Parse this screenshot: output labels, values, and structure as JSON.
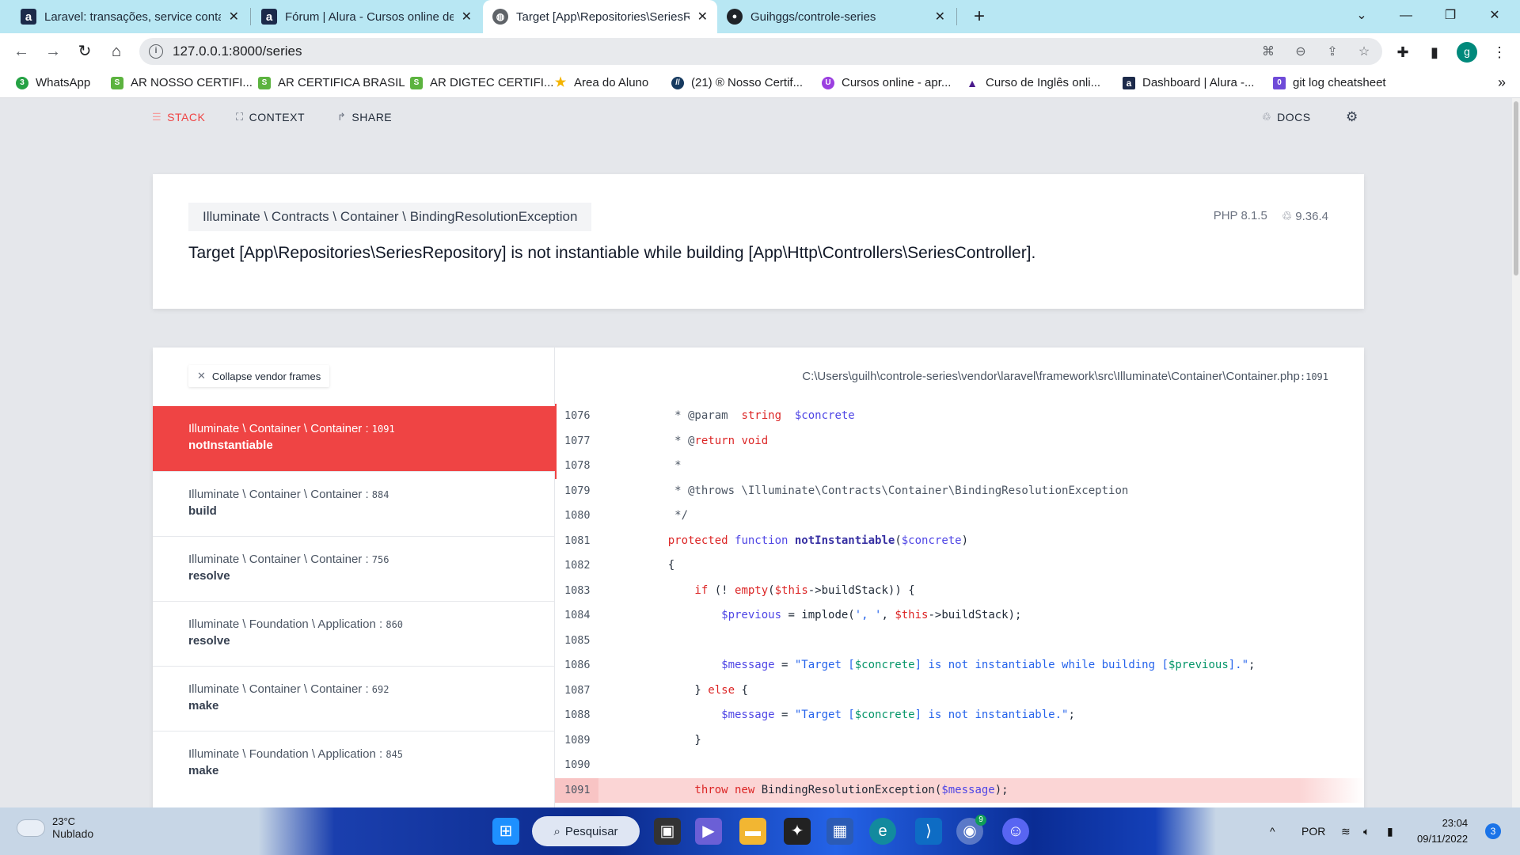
{
  "browser": {
    "tabs": [
      {
        "label": "Laravel: transações, service conta",
        "icon": "alura-icon",
        "active": false
      },
      {
        "label": "Fórum | Alura - Cursos online de",
        "icon": "alura-icon",
        "active": false
      },
      {
        "label": "Target [App\\Repositories\\SeriesR",
        "icon": "globe-icon",
        "active": true
      },
      {
        "label": "Guihggs/controle-series",
        "icon": "github-icon",
        "active": false
      }
    ],
    "close_glyph": "✕",
    "new_tab_glyph": "+",
    "url": "127.0.0.1:8000/series",
    "profile_initial": "g",
    "bookmarks": [
      {
        "label": "WhatsApp",
        "icon": "whatsapp-icon",
        "color": "#25a244",
        "glyph": "3"
      },
      {
        "label": "AR NOSSO CERTIFI...",
        "icon": "ar-certificado-icon",
        "color": "#5cb33f",
        "glyph": "S"
      },
      {
        "label": "AR CERTIFICA BRASIL",
        "icon": "ar-certificado-icon",
        "color": "#5cb33f",
        "glyph": "S"
      },
      {
        "label": "AR DIGTEC CERTIFI...",
        "icon": "ar-certificado-icon",
        "color": "#5cb33f",
        "glyph": "S"
      },
      {
        "label": "Area do Aluno",
        "icon": "star-icon",
        "color": "#f4b400",
        "glyph": "★"
      },
      {
        "label": "(21) ® Nosso Certif...",
        "icon": "nosso-certificado-icon",
        "color": "#163a5f",
        "glyph": "//"
      },
      {
        "label": "Cursos online - apr...",
        "icon": "cursos-online-icon",
        "color": "#9b3fe0",
        "glyph": "U"
      },
      {
        "label": "Curso de Inglês onli...",
        "icon": "sail-icon",
        "color": "#4a1a8c",
        "glyph": "▲"
      },
      {
        "label": "Dashboard | Alura -...",
        "icon": "alura-icon",
        "color": "#1c2a4a",
        "glyph": "a"
      },
      {
        "label": "git log cheatsheet",
        "icon": "paperclip-icon",
        "color": "#6f4bd8",
        "glyph": "0"
      }
    ],
    "bookmarks_more": "»"
  },
  "ignition": {
    "nav": {
      "stack": "STACK",
      "context": "CONTEXT",
      "share": "SHARE",
      "docs": "DOCS"
    },
    "exception": {
      "class": "Illuminate \\ Contracts \\ Container \\ BindingResolutionException",
      "php_version": "PHP 8.1.5",
      "laravel_version": "9.36.4",
      "message": "Target [App\\Repositories\\SeriesRepository] is not instantiable while building [App\\Http\\Controllers\\SeriesController]."
    },
    "collapse_vendor_frames": "Collapse vendor frames",
    "frames": [
      {
        "class": "Illuminate \\ Container \\ Container",
        "line": "1091",
        "function": "notInstantiable",
        "selected": true
      },
      {
        "class": "Illuminate \\ Container \\ Container",
        "line": "884",
        "function": "build",
        "selected": false
      },
      {
        "class": "Illuminate \\ Container \\ Container",
        "line": "756",
        "function": "resolve",
        "selected": false
      },
      {
        "class": "Illuminate \\ Foundation \\ Application",
        "line": "860",
        "function": "resolve",
        "selected": false
      },
      {
        "class": "Illuminate \\ Container \\ Container",
        "line": "692",
        "function": "make",
        "selected": false
      },
      {
        "class": "Illuminate \\ Foundation \\ Application",
        "line": "845",
        "function": "make",
        "selected": false
      }
    ],
    "file": {
      "path": "C:\\Users\\guilh\\controle-series\\vendor\\laravel\\framework\\src\\Illuminate\\Container\\Container.php",
      "line": "1091"
    },
    "highlighted_line": "1091",
    "code_lines": [
      {
        "no": "1076",
        "tokens": [
          [
            "c",
            "     * @param  "
          ],
          [
            "k",
            "string"
          ],
          [
            "c",
            "  "
          ],
          [
            "v",
            "$concrete"
          ]
        ]
      },
      {
        "no": "1077",
        "tokens": [
          [
            "c",
            "     * @"
          ],
          [
            "k",
            "return void"
          ]
        ]
      },
      {
        "no": "1078",
        "tokens": [
          [
            "c",
            "     *"
          ]
        ]
      },
      {
        "no": "1079",
        "tokens": [
          [
            "c",
            "     * @throws \\Illuminate\\Contracts\\Container\\BindingResolutionException"
          ]
        ]
      },
      {
        "no": "1080",
        "tokens": [
          [
            "c",
            "     */"
          ]
        ]
      },
      {
        "no": "1081",
        "tokens": [
          [
            "k",
            "    protected "
          ],
          [
            "v",
            "function "
          ],
          [
            "fnn",
            "notInstantiable"
          ],
          [
            "",
            "("
          ],
          [
            "v",
            "$concrete"
          ],
          [
            "",
            ")"
          ]
        ]
      },
      {
        "no": "1082",
        "tokens": [
          [
            "",
            "    {"
          ]
        ]
      },
      {
        "no": "1083",
        "tokens": [
          [
            "k",
            "        if "
          ],
          [
            "",
            "(! "
          ],
          [
            "k",
            "empty"
          ],
          [
            "",
            "("
          ],
          [
            "k",
            "$this"
          ],
          [
            "",
            "->buildStack)) {"
          ]
        ]
      },
      {
        "no": "1084",
        "tokens": [
          [
            "v",
            "            $previous"
          ],
          [
            "",
            " = implode("
          ],
          [
            "s",
            "', '"
          ],
          [
            "",
            ", "
          ],
          [
            "k",
            "$this"
          ],
          [
            "",
            "->buildStack);"
          ]
        ]
      },
      {
        "no": "1085",
        "tokens": [
          [
            "",
            ""
          ]
        ]
      },
      {
        "no": "1086",
        "tokens": [
          [
            "v",
            "            $message"
          ],
          [
            "",
            " = "
          ],
          [
            "s",
            "\"Target ["
          ],
          [
            "g",
            "$concrete"
          ],
          [
            "s",
            "] is not instantiable while building ["
          ],
          [
            "g",
            "$previous"
          ],
          [
            "s",
            "].\""
          ],
          [
            "",
            ";"
          ]
        ]
      },
      {
        "no": "1087",
        "tokens": [
          [
            "",
            "        } "
          ],
          [
            "k",
            "else"
          ],
          [
            "",
            " {"
          ]
        ]
      },
      {
        "no": "1088",
        "tokens": [
          [
            "v",
            "            $message"
          ],
          [
            "",
            " = "
          ],
          [
            "s",
            "\"Target ["
          ],
          [
            "g",
            "$concrete"
          ],
          [
            "s",
            "] is not instantiable.\""
          ],
          [
            "",
            ";"
          ]
        ]
      },
      {
        "no": "1089",
        "tokens": [
          [
            "",
            "        }"
          ]
        ]
      },
      {
        "no": "1090",
        "tokens": [
          [
            "",
            ""
          ]
        ]
      },
      {
        "no": "1091",
        "tokens": [
          [
            "k",
            "        throw new "
          ],
          [
            "",
            "BindingResolutionException("
          ],
          [
            "v",
            "$message"
          ],
          [
            "",
            ");"
          ]
        ]
      }
    ],
    "colors": {
      "accent": "#ef4444",
      "highlight_line": "#fbd5d5"
    }
  },
  "taskbar": {
    "weather_temp": "23°C",
    "weather_desc": "Nublado",
    "search_label": "Pesquisar",
    "language": "POR",
    "time": "23:04",
    "date": "09/11/2022",
    "notifications": "3",
    "chrome_badge": "9"
  }
}
